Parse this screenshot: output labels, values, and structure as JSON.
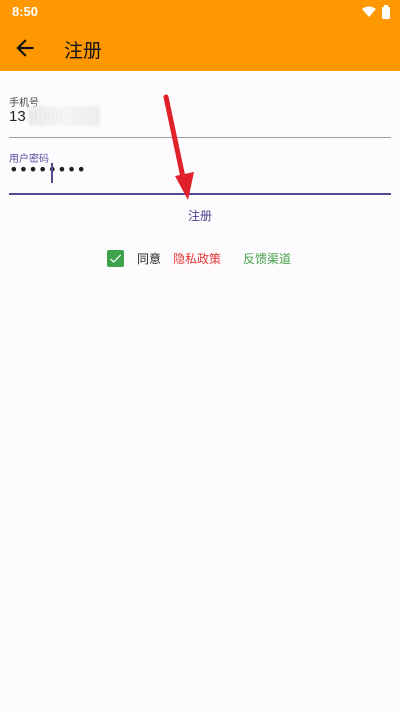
{
  "status_bar": {
    "time": "8:50"
  },
  "app_bar": {
    "title": "注册",
    "back_icon": "arrow-back-icon"
  },
  "form": {
    "phone_label": "手机号",
    "phone_value": "13          4960",
    "password_label": "用户密码",
    "password_value": "••••••••"
  },
  "register_label": "注册",
  "agreement": {
    "checked": true,
    "agree_label": "同意",
    "privacy_link": "隐私政策",
    "feedback_link": "反馈渠道"
  },
  "colors": {
    "accent": "#ff9800",
    "focus": "#54488f",
    "privacy": "#e53935",
    "feedback": "#43a047",
    "checkbox": "#3fa34d"
  }
}
